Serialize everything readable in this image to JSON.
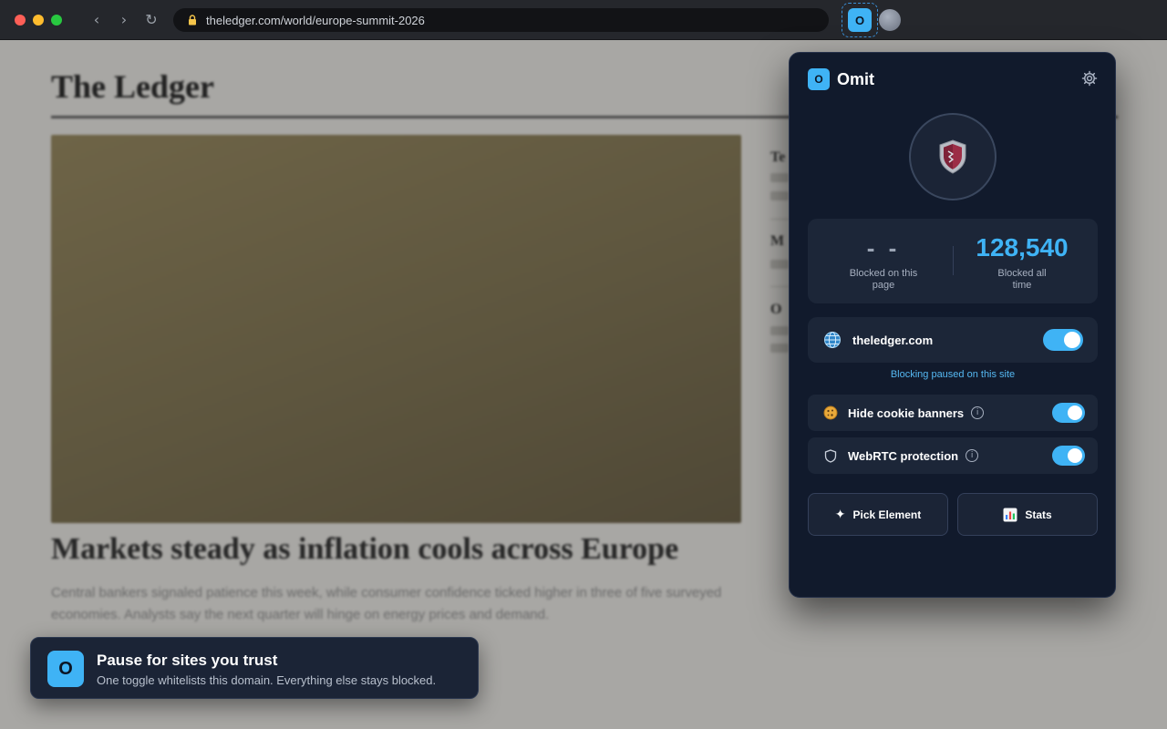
{
  "browser": {
    "url": "theledger.com/world/europe-summit-2026",
    "nav": {
      "back": "‹",
      "forward": "›",
      "reload": "↻"
    },
    "extension_icon_letter": "O"
  },
  "page": {
    "masthead": "The Ledger",
    "headline": "Markets steady as inflation cools across Europe",
    "dek": "Central bankers signaled patience this week, while consumer confidence ticked higher in three of five surveyed economies. Analysts say the next quarter will hinge on energy prices and demand.",
    "sidebar_items": [
      "Te",
      "M",
      "O"
    ]
  },
  "popup": {
    "app_name": "Omit",
    "logo_letter": "O",
    "stats": {
      "page_value": "- -",
      "page_label": "Blocked on this page",
      "total_value": "128,540",
      "total_label": "Blocked all time"
    },
    "site": {
      "domain": "theledger.com",
      "toggle_on": true,
      "note": "Blocking paused on this site"
    },
    "options": [
      {
        "label": "Hide cookie banners",
        "info": "i",
        "enabled": true,
        "icon": "cookie-icon"
      },
      {
        "label": "WebRTC protection",
        "info": "i",
        "enabled": true,
        "icon": "shield-icon"
      }
    ],
    "actions": {
      "pick_element": "Pick Element",
      "pick_icon": "✦",
      "stats": "Stats"
    }
  },
  "toast": {
    "logo_letter": "O",
    "title": "Pause for sites you trust",
    "subtitle": "One toggle whitelists this domain. Everything else stays blocked."
  },
  "colors": {
    "accent": "#3fb3f5",
    "popup_bg": "#111a2c",
    "card_bg": "#1c2638",
    "page_bg": "#a8a7a4"
  }
}
